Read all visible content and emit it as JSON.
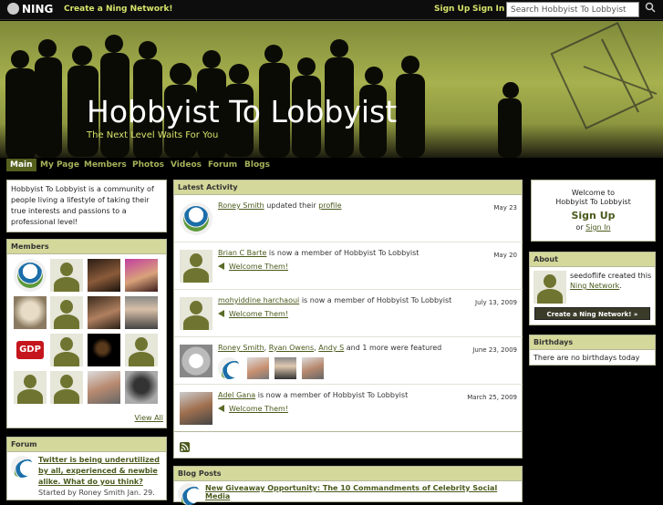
{
  "topbar": {
    "logo": "NING",
    "create_network": "Create a Ning Network!",
    "sign_up": "Sign Up",
    "sign_in": "Sign In",
    "search_value": "Search Hobbyist To Lobbyist"
  },
  "site": {
    "title": "Hobbyist To Lobbyist",
    "tagline": "The Next Level Waits For You"
  },
  "nav": [
    "Main",
    "My Page",
    "Members",
    "Photos",
    "Videos",
    "Forum",
    "Blogs"
  ],
  "about_text": "Hobbyist To Lobbyist is a community of people living a lifestyle of taking their true interests and passions to a professional level!",
  "members": {
    "heading": "Members",
    "view_all": "View All",
    "gdp_label": "GDP"
  },
  "forum": {
    "heading": "Forum",
    "topic": "Twitter is being underutilized by all, experienced & newbie alike. What do you think?",
    "started": "Started by Roney Smith Jan. 29."
  },
  "activity": {
    "heading": "Latest Activity",
    "items": [
      {
        "user": "Roney Smith",
        "text": " updated their ",
        "link": "profile",
        "date": "May 23"
      },
      {
        "user": "Brian C Barte",
        "text": " is now a member of Hobbyist To Lobbyist",
        "welcome": "Welcome Them!",
        "date": "May 20"
      },
      {
        "user": "mohyiddine harchaoui",
        "text": " is now a member of Hobbyist To Lobbyist",
        "welcome": "Welcome Them!",
        "date": "July 13, 2009"
      },
      {
        "user": "Roney Smith",
        "sep1": ", ",
        "user2": "Ryan Owens",
        "sep2": ", ",
        "user3": "Andy S",
        "text": " and 1 more were featured",
        "date": "June 23, 2009"
      },
      {
        "user": "Adel Gana",
        "text": " is now a member of Hobbyist To Lobbyist",
        "welcome": "Welcome Them!",
        "date": "March 25, 2009"
      }
    ]
  },
  "blog": {
    "heading": "Blog Posts",
    "title": "New Giveaway Opportunity: The 10 Commandments of Celebrity Social Media"
  },
  "welcome_box": {
    "line1": "Welcome to",
    "line2": "Hobbyist To Lobbyist",
    "sign_up": "Sign Up",
    "or": "or ",
    "sign_in": "Sign In"
  },
  "about_box": {
    "heading": "About",
    "creator": "seedoflife",
    "created": " created this ",
    "network_link": "Ning Network",
    "period": ".",
    "button": "Create a Ning Network! »"
  },
  "birthdays": {
    "heading": "Birthdays",
    "text": "There are no birthdays today"
  },
  "colors": {
    "accent": "#d6e36a",
    "box_header": "#d4d89a",
    "link": "#4a5a1c",
    "banner": "#a7b14e"
  }
}
